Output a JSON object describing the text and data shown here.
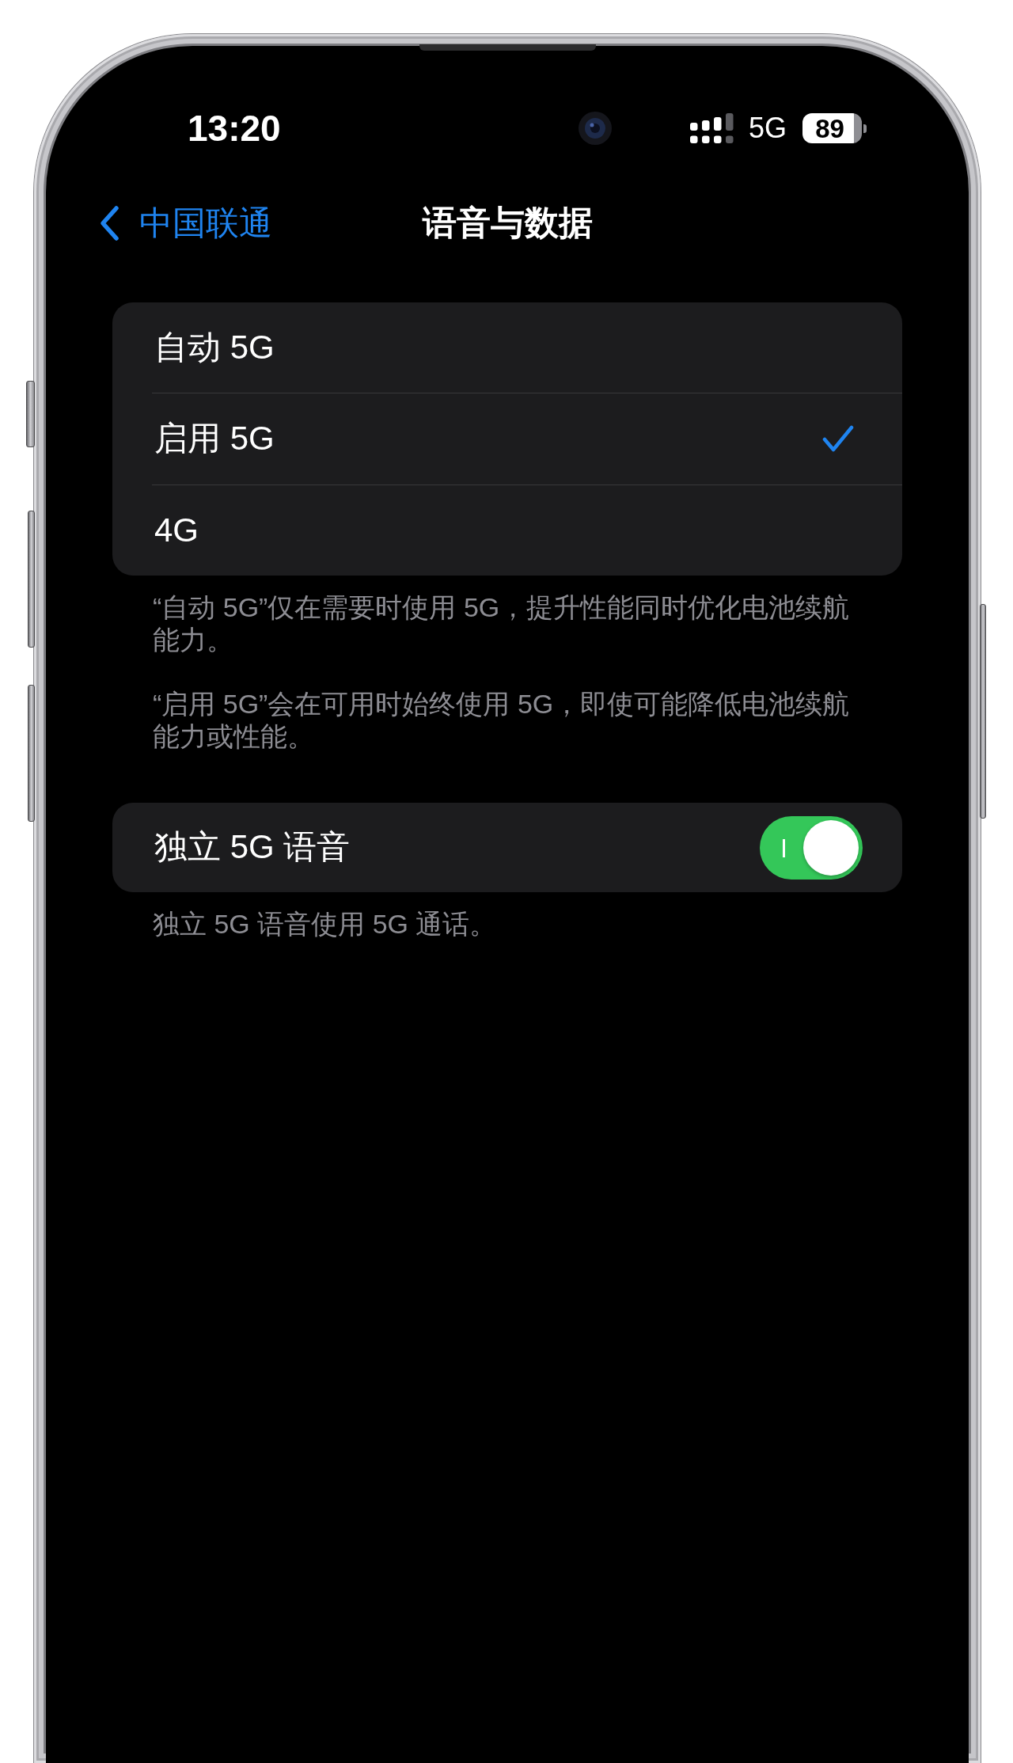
{
  "status_bar": {
    "time": "13:20",
    "network": "5G",
    "battery": "89"
  },
  "nav_bar": {
    "back": "中国联通",
    "title": "语音与数据"
  },
  "network_mode": {
    "options": [
      {
        "label": "自动 5G",
        "selected": false
      },
      {
        "label": "启用 5G",
        "selected": true
      },
      {
        "label": "4G",
        "selected": false
      }
    ],
    "footer": [
      "“自动 5G”仅在需要时使用 5G，提升性能同时优化电池续航能力。",
      "“启用 5G”会在可用时始终使用 5G，即使可能降低电池续航能力或性能。"
    ]
  },
  "standalone_voice": {
    "label": "独立 5G 语音",
    "on": true,
    "footer": "独立 5G 语音使用 5G 通话。"
  }
}
